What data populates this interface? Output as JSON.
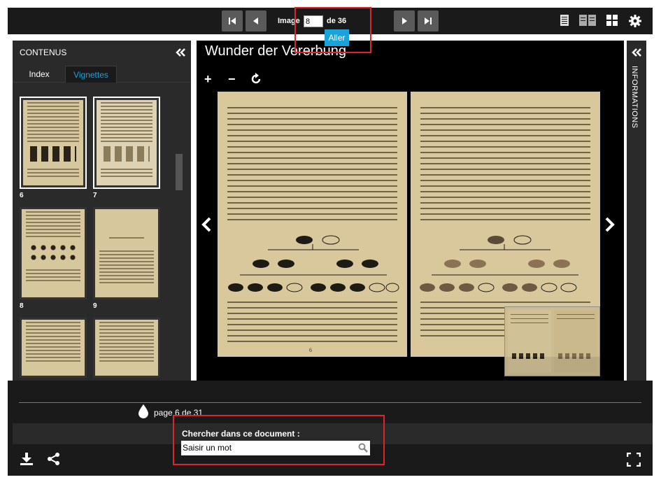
{
  "toolbar": {
    "image_label": "Image",
    "image_value": "8",
    "image_total": "de 36",
    "go_label": "Aller",
    "nav_icons": [
      "first-page-icon",
      "previous-page-icon",
      "next-page-icon",
      "last-page-icon"
    ],
    "view_icons": [
      "single-page-icon",
      "double-page-icon",
      "grid-view-icon",
      "settings-gear-icon"
    ]
  },
  "left_panel": {
    "title": "CONTENUS",
    "tabs": [
      "Index",
      "Vignettes"
    ],
    "active_tab": "Vignettes",
    "thumbnails": [
      {
        "num": "6",
        "selected": true
      },
      {
        "num": "7",
        "selected": true
      },
      {
        "num": "8",
        "selected": false
      },
      {
        "num": "9",
        "selected": false
      },
      {
        "num": "",
        "selected": false
      },
      {
        "num": "",
        "selected": false
      }
    ]
  },
  "viewer": {
    "title": "Wunder der Vererbung",
    "zoom_in": "+",
    "zoom_out": "−",
    "page_numbers": [
      "6",
      ""
    ]
  },
  "right_panel": {
    "label": "INFORMATIONS"
  },
  "footer": {
    "page_text": "page 6 de 31",
    "search_label": "Chercher dans ce document :",
    "search_value": "Saisir un mot"
  },
  "colors": {
    "accent": "#1aa3d9",
    "highlight_box": "#e0242c",
    "panel": "#2a2a2a",
    "toolbar": "#1a1a1a",
    "page_paper": "#d9c89c"
  }
}
